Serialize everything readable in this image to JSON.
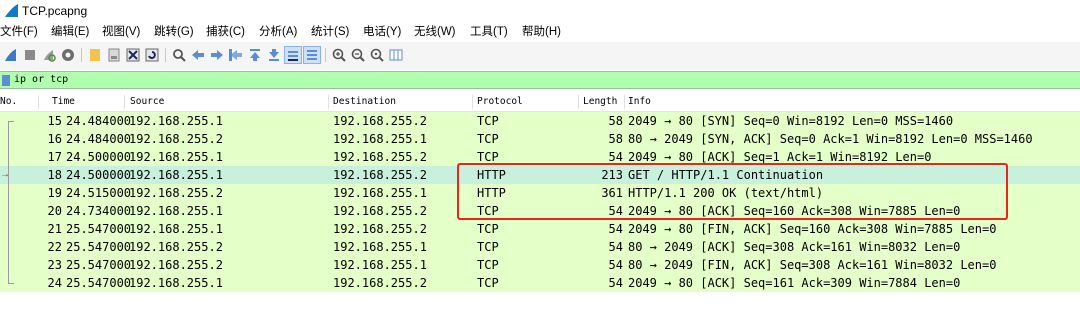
{
  "window": {
    "title": "TCP.pcapng"
  },
  "menu": [
    "文件(F)",
    "编辑(E)",
    "视图(V)",
    "跳转(G)",
    "捕获(C)",
    "分析(A)",
    "统计(S)",
    "电话(Y)",
    "无线(W)",
    "工具(T)",
    "帮助(H)"
  ],
  "toolbar": {
    "icons": [
      "start-capture-icon",
      "stop-capture-icon",
      "restart-capture-icon",
      "capture-options-icon",
      "open-file-icon",
      "save-file-icon",
      "close-file-icon",
      "reload-file-icon",
      "find-packet-icon",
      "go-back-icon",
      "go-forward-icon",
      "go-to-packet-icon",
      "go-first-icon",
      "go-last-icon",
      "autoscroll-icon",
      "colorize-icon",
      "zoom-in-icon",
      "zoom-out-icon",
      "zoom-normal-icon",
      "resize-columns-icon"
    ]
  },
  "filter": {
    "value": "ip or tcp"
  },
  "columns": {
    "no": "No.",
    "time": "Time",
    "source": "Source",
    "destination": "Destination",
    "protocol": "Protocol",
    "length": "Length",
    "info": "Info"
  },
  "colors": {
    "row_bg": "#e4ffc7",
    "selected_bg": "#c7f1dc",
    "filter_bg": "#afffaf",
    "highlight": "#e8261e"
  },
  "packets": [
    {
      "no": "15",
      "time": "24.484000",
      "src": "192.168.255.1",
      "dst": "192.168.255.2",
      "proto": "TCP",
      "len": "58",
      "info": "2049 → 80 [SYN] Seq=0 Win=8192 Len=0 MSS=1460"
    },
    {
      "no": "16",
      "time": "24.484000",
      "src": "192.168.255.2",
      "dst": "192.168.255.1",
      "proto": "TCP",
      "len": "58",
      "info": "80 → 2049 [SYN, ACK] Seq=0 Ack=1 Win=8192 Len=0 MSS=1460"
    },
    {
      "no": "17",
      "time": "24.500000",
      "src": "192.168.255.1",
      "dst": "192.168.255.2",
      "proto": "TCP",
      "len": "54",
      "info": "2049 → 80 [ACK] Seq=1 Ack=1 Win=8192 Len=0"
    },
    {
      "no": "18",
      "time": "24.500000",
      "src": "192.168.255.1",
      "dst": "192.168.255.2",
      "proto": "HTTP",
      "len": "213",
      "info": "GET / HTTP/1.1 Continuation"
    },
    {
      "no": "19",
      "time": "24.515000",
      "src": "192.168.255.2",
      "dst": "192.168.255.1",
      "proto": "HTTP",
      "len": "361",
      "info": "HTTP/1.1 200 OK  (text/html)"
    },
    {
      "no": "20",
      "time": "24.734000",
      "src": "192.168.255.1",
      "dst": "192.168.255.2",
      "proto": "TCP",
      "len": "54",
      "info": "2049 → 80 [ACK] Seq=160 Ack=308 Win=7885 Len=0"
    },
    {
      "no": "21",
      "time": "25.547000",
      "src": "192.168.255.1",
      "dst": "192.168.255.2",
      "proto": "TCP",
      "len": "54",
      "info": "2049 → 80 [FIN, ACK] Seq=160 Ack=308 Win=7885 Len=0"
    },
    {
      "no": "22",
      "time": "25.547000",
      "src": "192.168.255.2",
      "dst": "192.168.255.1",
      "proto": "TCP",
      "len": "54",
      "info": "80 → 2049 [ACK] Seq=308 Ack=161 Win=8032 Len=0"
    },
    {
      "no": "23",
      "time": "25.547000",
      "src": "192.168.255.2",
      "dst": "192.168.255.1",
      "proto": "TCP",
      "len": "54",
      "info": "80 → 2049 [FIN, ACK] Seq=308 Ack=161 Win=8032 Len=0"
    },
    {
      "no": "24",
      "time": "25.547000",
      "src": "192.168.255.1",
      "dst": "192.168.255.2",
      "proto": "TCP",
      "len": "54",
      "info": "2049 → 80 [ACK] Seq=161 Ack=309 Win=7884 Len=0"
    }
  ]
}
